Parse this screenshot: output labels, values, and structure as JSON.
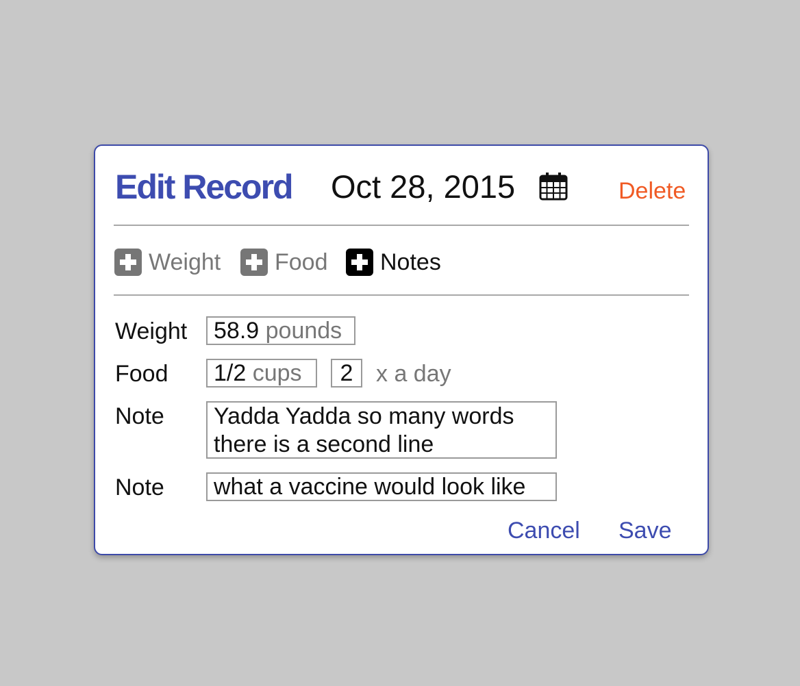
{
  "dialog": {
    "title": "Edit Record",
    "date": "Oct 28, 2015",
    "calendar_icon": "calendar-icon",
    "delete_label": "Delete"
  },
  "add_buttons": [
    {
      "label": "Weight",
      "icon": "plus-icon",
      "active": false
    },
    {
      "label": "Food",
      "icon": "plus-icon",
      "active": false
    },
    {
      "label": "Notes",
      "icon": "plus-icon",
      "active": true
    }
  ],
  "fields": {
    "weight": {
      "label": "Weight",
      "value": "58.9",
      "unit": "pounds"
    },
    "food": {
      "label": "Food",
      "amount": "1/2",
      "unit": "cups",
      "times": "2",
      "times_suffix": "x a day"
    },
    "notes": [
      {
        "label": "Note",
        "line1": "Yadda Yadda so many words",
        "line2": "there is a second line"
      },
      {
        "label": "Note",
        "line1": "what a vaccine would look like"
      }
    ]
  },
  "actions": {
    "cancel_label": "Cancel",
    "save_label": "Save"
  },
  "colors": {
    "accent": "#3d4cb0",
    "danger": "#f05a24",
    "background": "#c8c8c8",
    "inactive": "#767676"
  }
}
